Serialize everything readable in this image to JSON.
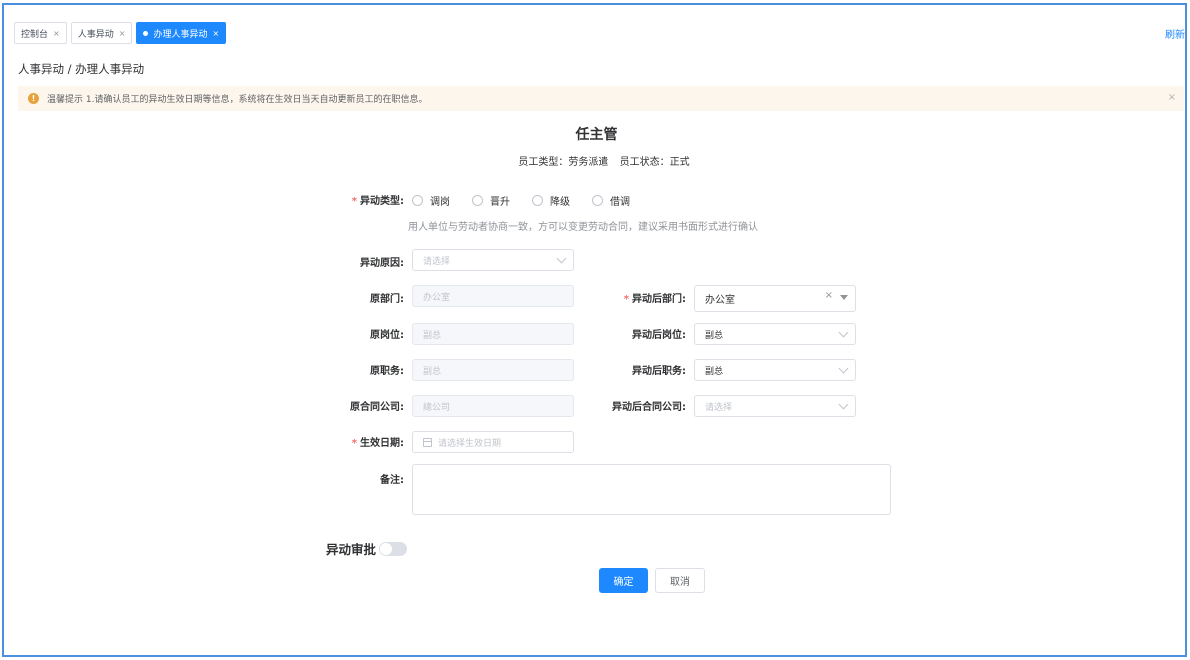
{
  "tabs": [
    {
      "label": "控制台",
      "close": "×"
    },
    {
      "label": "人事异动",
      "close": "×"
    },
    {
      "label": "办理人事异动",
      "close": "×"
    }
  ],
  "refresh_label": "刷新",
  "breadcrumb": "人事异动 / 办理人事异动",
  "alert": {
    "icon": "!",
    "text": "温馨提示 1.请确认员工的异动生效日期等信息，系统将在生效日当天自动更新员工的在职信息。",
    "close": "×"
  },
  "title": "任主管",
  "subtitle": {
    "type": "员工类型：劳务派遣",
    "status": "员工状态：正式"
  },
  "form": {
    "change_type_label": "异动类型:",
    "change_type_options": [
      "调岗",
      "晋升",
      "降级",
      "借调"
    ],
    "hint": "用人单位与劳动者协商一致，方可以变更劳动合同，建议采用书面形式进行确认",
    "reason_label": "异动原因:",
    "reason_placeholder": "请选择",
    "orig_dept_label": "原部门:",
    "orig_dept_value": "办公室",
    "new_dept_label": "异动后部门:",
    "new_dept_value": "办公室",
    "orig_post_label": "原岗位:",
    "orig_post_value": "副总",
    "new_post_label": "异动后岗位:",
    "new_post_value": "副总",
    "orig_duty_label": "原职务:",
    "orig_duty_value": "副总",
    "new_duty_label": "异动后职务:",
    "new_duty_value": "副总",
    "orig_company_label": "原合同公司:",
    "orig_company_value": "總公司",
    "new_company_label": "异动后合同公司:",
    "new_company_placeholder": "请选择",
    "effective_label": "生效日期:",
    "effective_placeholder": "请选择生效日期",
    "remark_label": "备注:"
  },
  "approval_label": "异动审批",
  "buttons": {
    "confirm": "确定",
    "cancel": "取消"
  },
  "colors": {
    "primary": "#1e88ff",
    "required": "#f56c6c",
    "alert_bg": "#fdf6ec",
    "alert_icon": "#e6a23c"
  }
}
